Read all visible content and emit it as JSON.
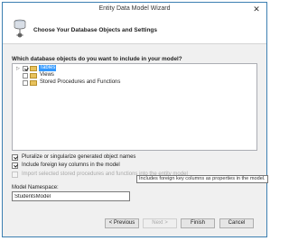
{
  "window": {
    "title": "Entity Data Model Wizard",
    "close_glyph": "✕"
  },
  "header": {
    "title": "Choose Your Database Objects and Settings"
  },
  "tree": {
    "question": "Which database objects do you want to include in your model?",
    "items": [
      {
        "label": "Tables",
        "checked": true,
        "selected": true
      },
      {
        "label": "Views",
        "checked": false,
        "selected": false
      },
      {
        "label": "Stored Procedures and Functions",
        "checked": false,
        "selected": false
      }
    ]
  },
  "options": [
    {
      "label": "Pluralize or singularize generated object names",
      "checked": true,
      "disabled": false
    },
    {
      "label": "Include foreign key columns in the model",
      "checked": true,
      "disabled": false
    },
    {
      "label": "Import selected stored procedures and functions into the entity model",
      "checked": false,
      "disabled": true
    }
  ],
  "tooltip": {
    "text": "Includes foreign key columns as properties in the model."
  },
  "namespace": {
    "label": "Model Namespace:",
    "value": "StudentsModel"
  },
  "buttons": {
    "previous": "< Previous",
    "next": "Next >",
    "finish": "Finish",
    "cancel": "Cancel"
  },
  "colors": {
    "accent": "#3399ff",
    "border": "#3c7fb1"
  }
}
